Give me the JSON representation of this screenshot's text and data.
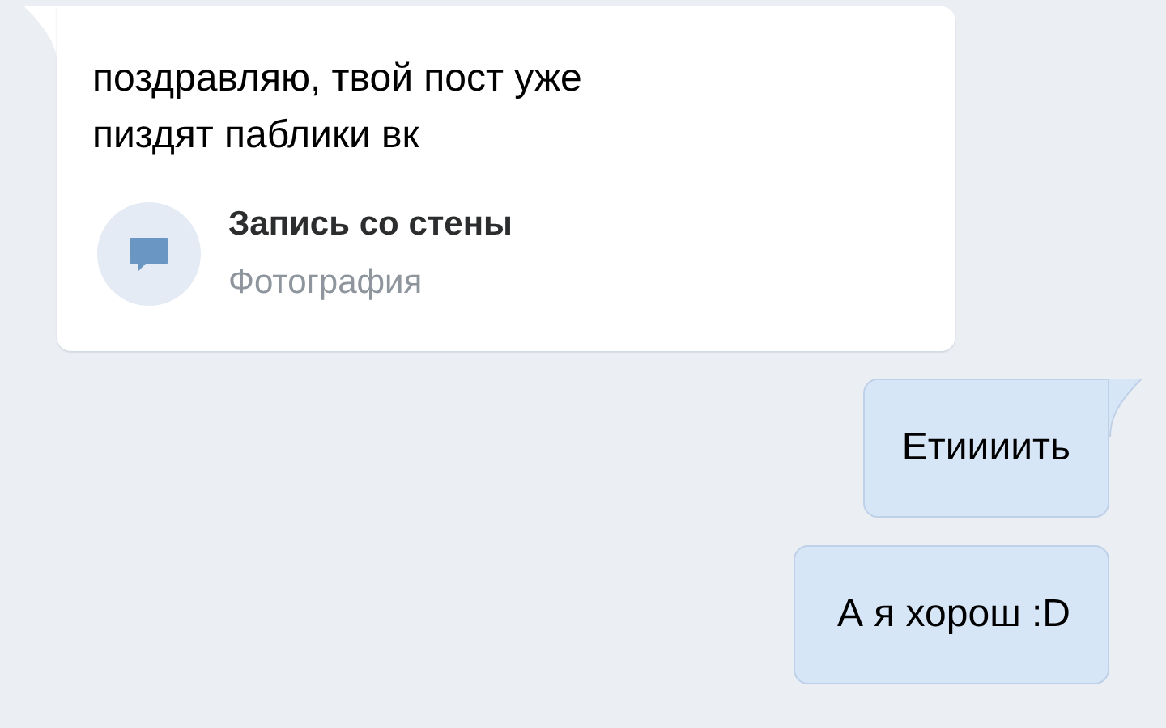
{
  "messages": [
    {
      "kind": "incoming",
      "tail": true,
      "text": "поздравляю, твой пост уже\nпиздят паблики вк",
      "attachment": {
        "title": "Запись со стены",
        "subtitle": "Фотография"
      }
    },
    {
      "kind": "outgoing",
      "tail": true,
      "text": "Етиииить"
    },
    {
      "kind": "outgoing",
      "tail": false,
      "text": "А я хорош :D"
    }
  ]
}
